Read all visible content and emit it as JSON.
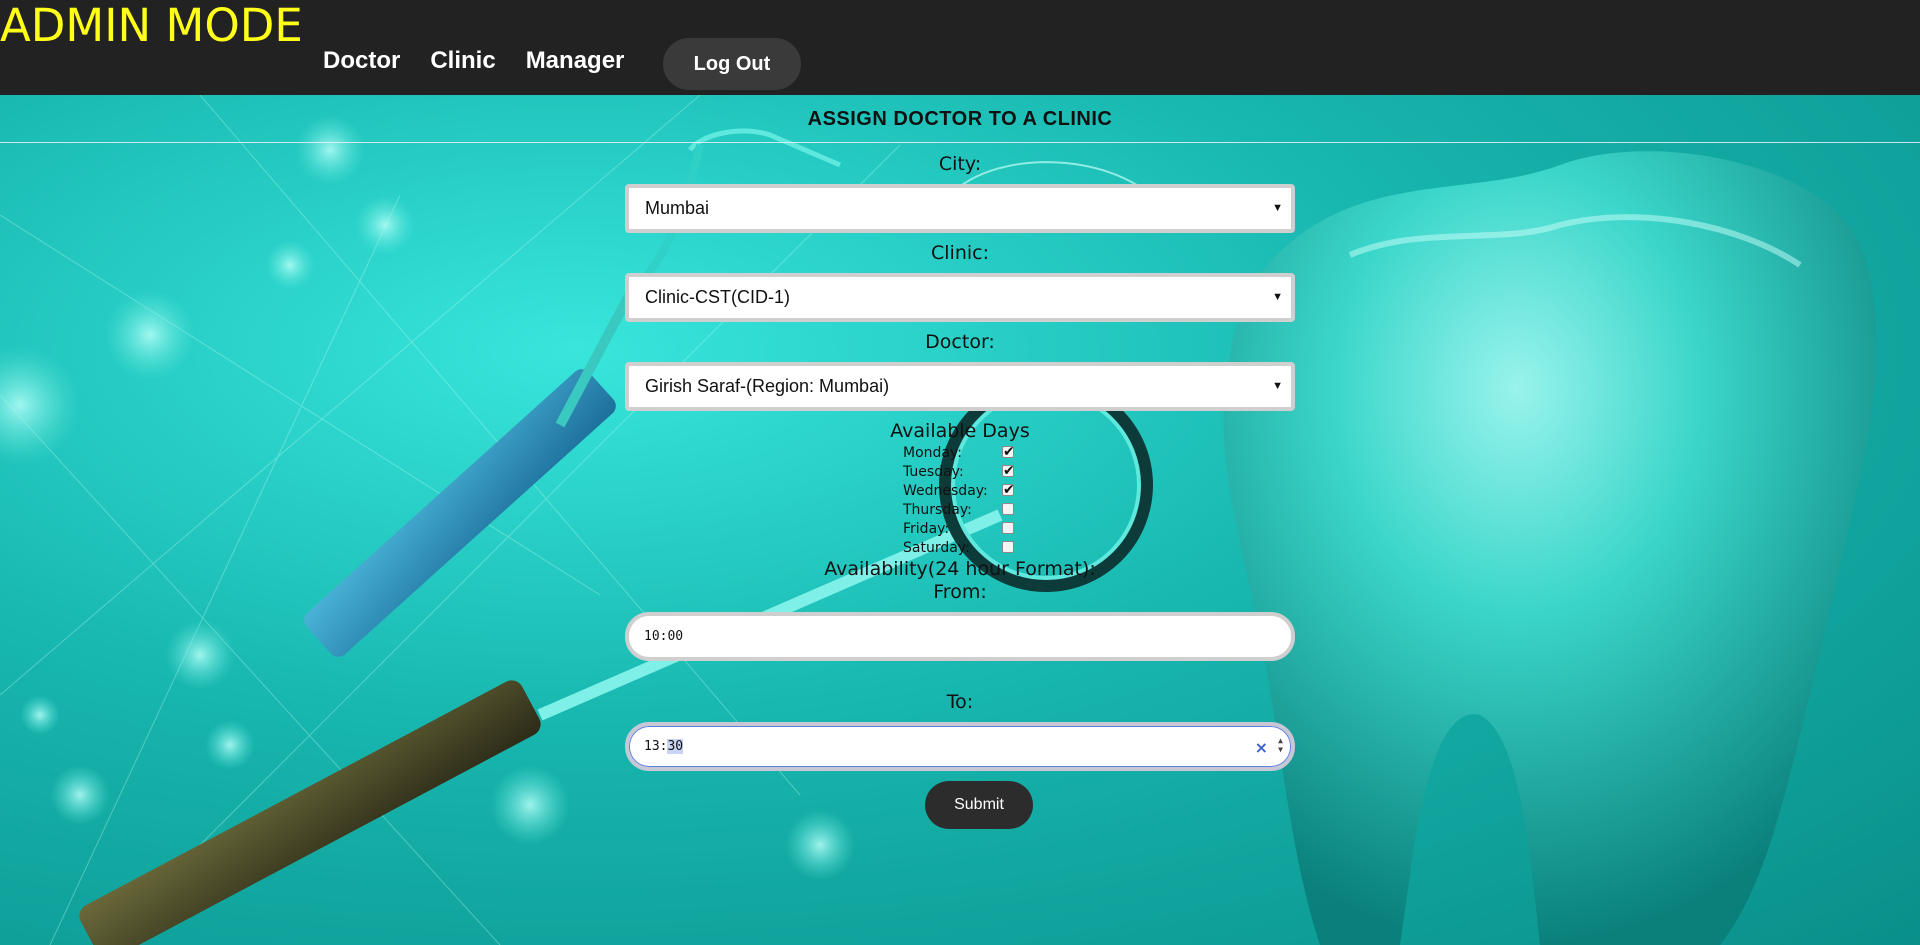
{
  "header": {
    "brand": "ADMIN MODE",
    "nav": [
      "Doctor",
      "Clinic",
      "Manager"
    ],
    "logout_label": "Log Out"
  },
  "form": {
    "title": "ASSIGN DOCTOR TO A CLINIC",
    "city_label": "City:",
    "city_value": "Mumbai",
    "clinic_label": "Clinic:",
    "clinic_value": "Clinic-CST(CID-1)",
    "doctor_label": "Doctor:",
    "doctor_value": "Girish Saraf-(Region: Mumbai)",
    "days_label": "Available Days",
    "days": [
      {
        "label": "Monday:",
        "checked": true
      },
      {
        "label": "Tuesday:",
        "checked": true
      },
      {
        "label": "Wednesday:",
        "checked": true
      },
      {
        "label": "Thursday:",
        "checked": false
      },
      {
        "label": "Friday:",
        "checked": false
      },
      {
        "label": "Saturday:",
        "checked": false
      }
    ],
    "availability_label": "Availability(24 hour Format):",
    "from_label": "From:",
    "from_value": "10:00",
    "to_label": "To:",
    "to_hours": "13:",
    "to_minutes": "30",
    "clear_glyph": "×",
    "submit_label": "Submit"
  },
  "colors": {
    "header_bg": "#222222",
    "brand": "#ffff1a",
    "accent_teal": "#1ab8b0"
  }
}
